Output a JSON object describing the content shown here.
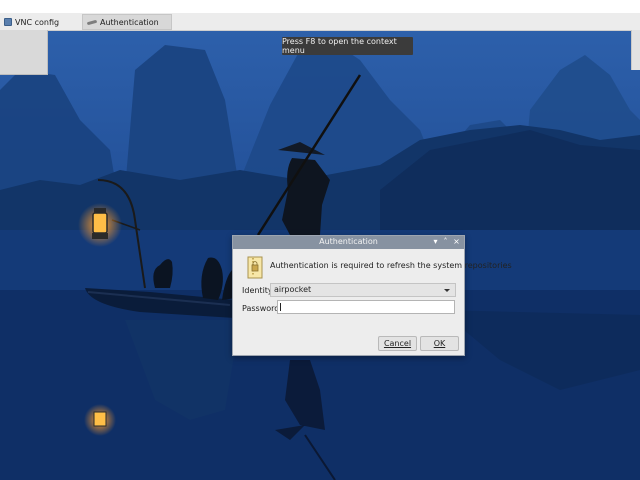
{
  "taskbar": {
    "items": [
      {
        "label": "VNC config",
        "icon": "vnc-icon"
      },
      {
        "label": "Authentication",
        "icon": "key-icon"
      }
    ]
  },
  "hint": {
    "text": "Press F8 to open the context menu"
  },
  "dialog": {
    "title": "Authentication",
    "controls": {
      "minimize": "▾",
      "maximize": "˄",
      "close": "×"
    },
    "message": "Authentication is required to refresh the system repositories",
    "identity": {
      "label": "Identity:",
      "value": "airpocket"
    },
    "password": {
      "label": "Password:",
      "value": ""
    },
    "buttons": {
      "cancel": "Cancel",
      "ok": "OK"
    }
  },
  "colors": {
    "titlebar": "#8792a1",
    "wallpaper_sky": "#2a5aa4",
    "wallpaper_water": "#0f2e66",
    "lantern": "#ffb43a"
  }
}
